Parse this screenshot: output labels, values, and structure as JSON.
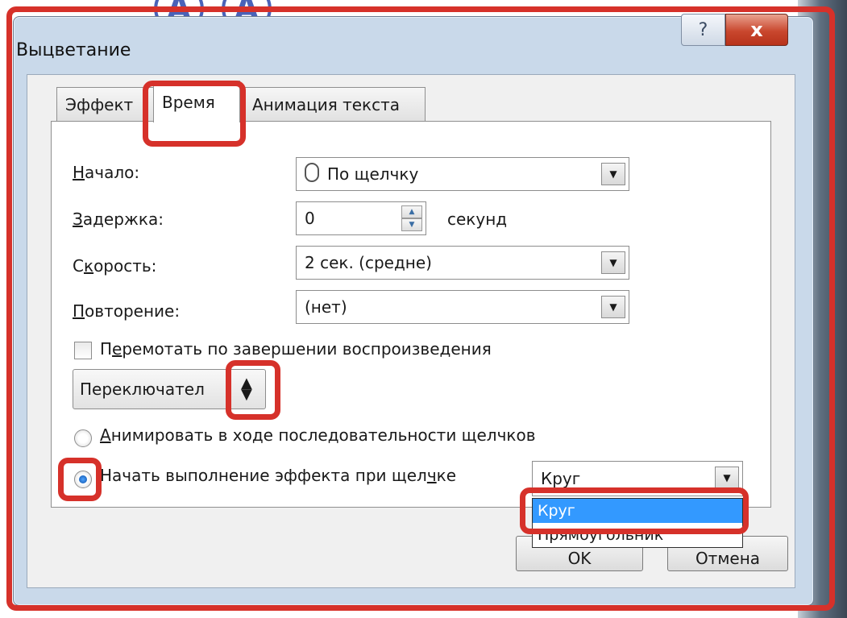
{
  "window": {
    "title": "Выцветание",
    "help_glyph": "?",
    "close_glyph": "x"
  },
  "tabs": [
    {
      "label": "Эффект",
      "active": false
    },
    {
      "label": "Время",
      "active": true
    },
    {
      "label": "Анимация текста",
      "active": false
    }
  ],
  "timing": {
    "start": {
      "label_u": "Н",
      "label_rest": "ачало:",
      "value": "По щелчку",
      "icon": "mouse-icon"
    },
    "delay": {
      "label_u": "З",
      "label_rest": "адержка:",
      "value": "0",
      "unit": "секунд"
    },
    "speed": {
      "label_pre": "С",
      "label_u": "к",
      "label_rest": "орость:",
      "value": "2 сек. (средне)"
    },
    "repeat": {
      "label_u": "П",
      "label_rest": "овторение:",
      "value": "(нет)"
    }
  },
  "rewind": {
    "checked": false,
    "label_pre": "П",
    "label_u": "е",
    "label_rest": "ремотать по завершении воспроизведения"
  },
  "triggers": {
    "toggle_label": "Переключател",
    "toggle_icon": "expand-collapse-icon",
    "option1": {
      "label_u": "А",
      "label_rest": "нимировать в ходе последовательности щелчков",
      "checked": false
    },
    "option2": {
      "label_pre": "Начать выполнение эффекта при щел",
      "label_u": "ч",
      "label_rest": "ке",
      "checked": true
    },
    "trigger_value": "Круг",
    "dropdown_options": [
      "Круг",
      "Прямоугольник"
    ]
  },
  "buttons": {
    "ok": "OK",
    "cancel": "Отмена"
  },
  "highlight_color": "#d6312a"
}
